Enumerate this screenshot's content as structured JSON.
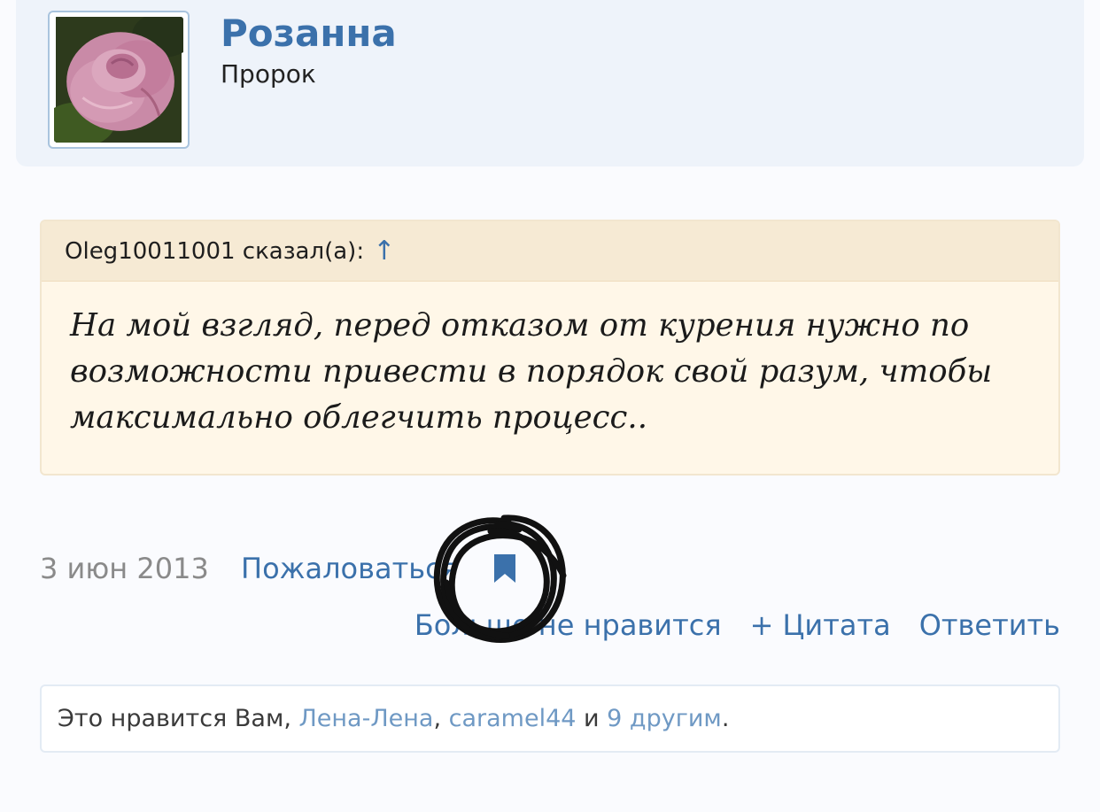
{
  "user": {
    "name": "Розанна",
    "title": "Пророк",
    "avatar_icon": "rose-avatar"
  },
  "quote": {
    "author_line": "Oleg10011001 сказал(а):",
    "jump_arrow": "↑",
    "text": "На мой взгляд, перед отказом от курения нужно по возможности привести в порядок свой разум, чтобы максимально облегчить процесс.."
  },
  "post": {
    "date": "3 июн 2013",
    "report_label": "Пожаловаться",
    "bookmark_icon": "bookmark-icon"
  },
  "actions": {
    "unlike_label": "Больше не нравится",
    "quote_label": "+ Цитата",
    "reply_label": "Ответить"
  },
  "likes": {
    "prefix": "Это нравится Вам, ",
    "user1": "Лена-Лена",
    "sep1": ", ",
    "user2": "caramel44",
    "sep2": " и ",
    "others": "9 другим",
    "suffix": "."
  },
  "colors": {
    "link": "#3b71ab",
    "quote_background": "#fff7e8",
    "quote_header": "#f6ead4",
    "card_background": "#eef3fa"
  }
}
